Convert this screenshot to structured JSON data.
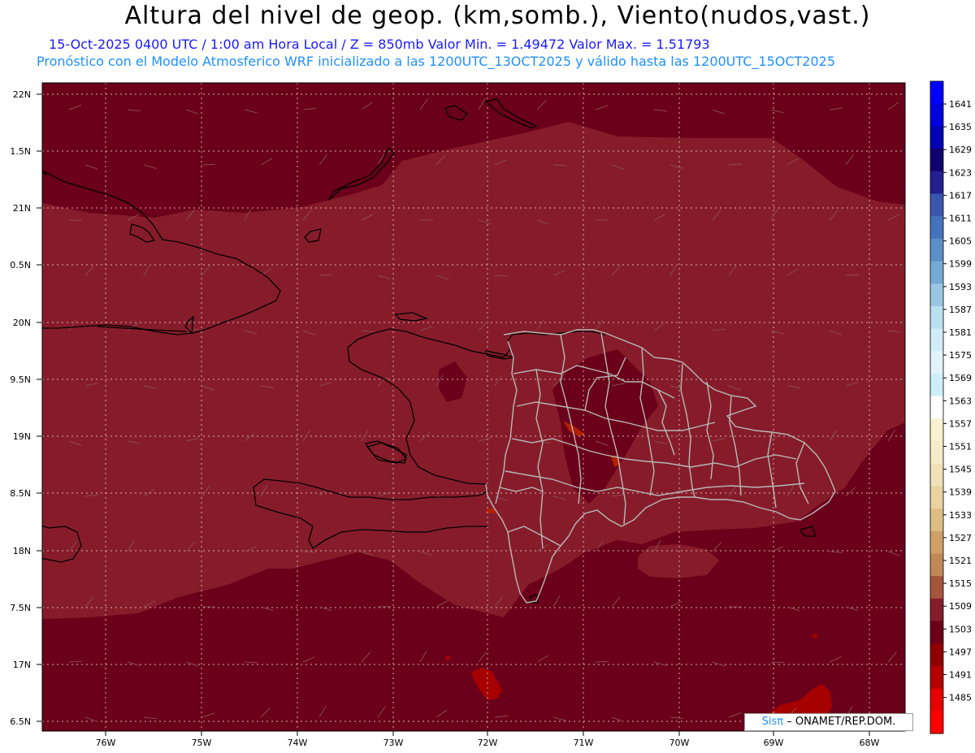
{
  "header": {
    "title": "Altura del nivel de geop. (km,somb.), Viento(nudos,vast.)",
    "subtitle_1": "15-Oct-2025  0400 UTC / 1:00 am Hora Local / Z = 850mb    Valor Min. = 1.49472  Valor Max. = 1.51793",
    "subtitle_2": "Pronóstico con el Modelo Atmosferico WRF inicializado a las 1200UTC_13OCT2025 y válido hasta las  1200UTC_15OCT2025"
  },
  "map": {
    "lon_labels": [
      "76W",
      "75W",
      "74W",
      "73W",
      "72W",
      "71W",
      "70W",
      "69W",
      "68W"
    ],
    "lat_labels": [
      "22N",
      "1.5N",
      "21N",
      "0.5N",
      "20N",
      "9.5N",
      "19N",
      "8.5N",
      "18N",
      "7.5N",
      "17N",
      "6.5N"
    ],
    "colors": {
      "field_dark": "#6a0019",
      "field_light": "#861c2a",
      "coast_line": "#000000",
      "province_line": "#b8b8b8"
    }
  },
  "colorbar": {
    "labels": [
      "1641",
      "1635",
      "1629",
      "1623",
      "1617",
      "1611",
      "1605",
      "1599",
      "1593",
      "1587",
      "1581",
      "1575",
      "1569",
      "1563",
      "1557",
      "1551",
      "1545",
      "1539",
      "1533",
      "1527",
      "1521",
      "1515",
      "1509",
      "1503",
      "1497",
      "1491",
      "1485"
    ],
    "colors": [
      "#0000ff",
      "#0000dd",
      "#0000b4",
      "#12006e",
      "#251f8f",
      "#3a55ad",
      "#4473bb",
      "#5b8fc8",
      "#74a8d5",
      "#98c6e3",
      "#b9e0ef",
      "#d0ecf6",
      "#e2f3fa",
      "#cdeef8",
      "#ffffff",
      "#fbf2d0",
      "#f6ecc9",
      "#f0e1b7",
      "#e8d3a0",
      "#ddbd84",
      "#cfa169",
      "#c28856",
      "#a4553c",
      "#861c2a",
      "#6a0019",
      "#900000",
      "#b40000",
      "#e60000",
      "#ff0000"
    ]
  },
  "credit": {
    "sis": "Sisπ",
    "rest": "– ONAMET/REP.DOM."
  }
}
